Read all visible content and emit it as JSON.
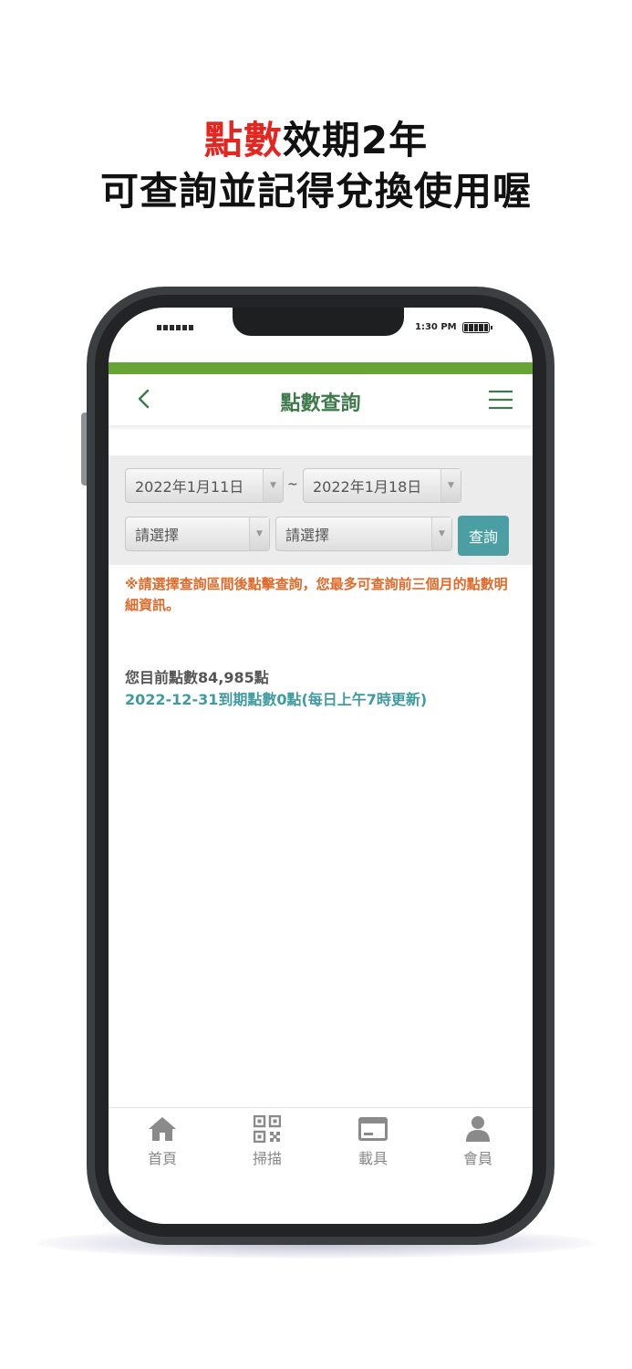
{
  "promo": {
    "line1_red": "點數",
    "line1_rest": "效期2年",
    "line2": "可查詢並記得兌換使用喔"
  },
  "status_bar": {
    "time": "1:30 PM"
  },
  "header": {
    "title": "點數查詢"
  },
  "filter": {
    "start_date": "2022年1月11日",
    "separator": "~",
    "end_date": "2022年1月18日",
    "select1": "請選擇",
    "select2": "請選擇",
    "query_label": "查詢"
  },
  "notice": "※請選擇查詢區間後點擊查詢，您最多可查詢前三個月的點數明細資訊。",
  "summary": {
    "current_points": "您目前點數84,985點",
    "expiry": "2022-12-31到期點數0點(每日上午7時更新)"
  },
  "bottom_nav": {
    "items": [
      {
        "label": "首頁",
        "icon": "home-icon"
      },
      {
        "label": "掃描",
        "icon": "qr-code-icon"
      },
      {
        "label": "載具",
        "icon": "card-icon"
      },
      {
        "label": "會員",
        "icon": "user-icon"
      }
    ]
  },
  "colors": {
    "accent_green": "#66a436",
    "title_green": "#3f7a4d",
    "teal": "#4b9ea2",
    "notice_orange": "#e06a2a",
    "promo_red": "#e3261f"
  }
}
